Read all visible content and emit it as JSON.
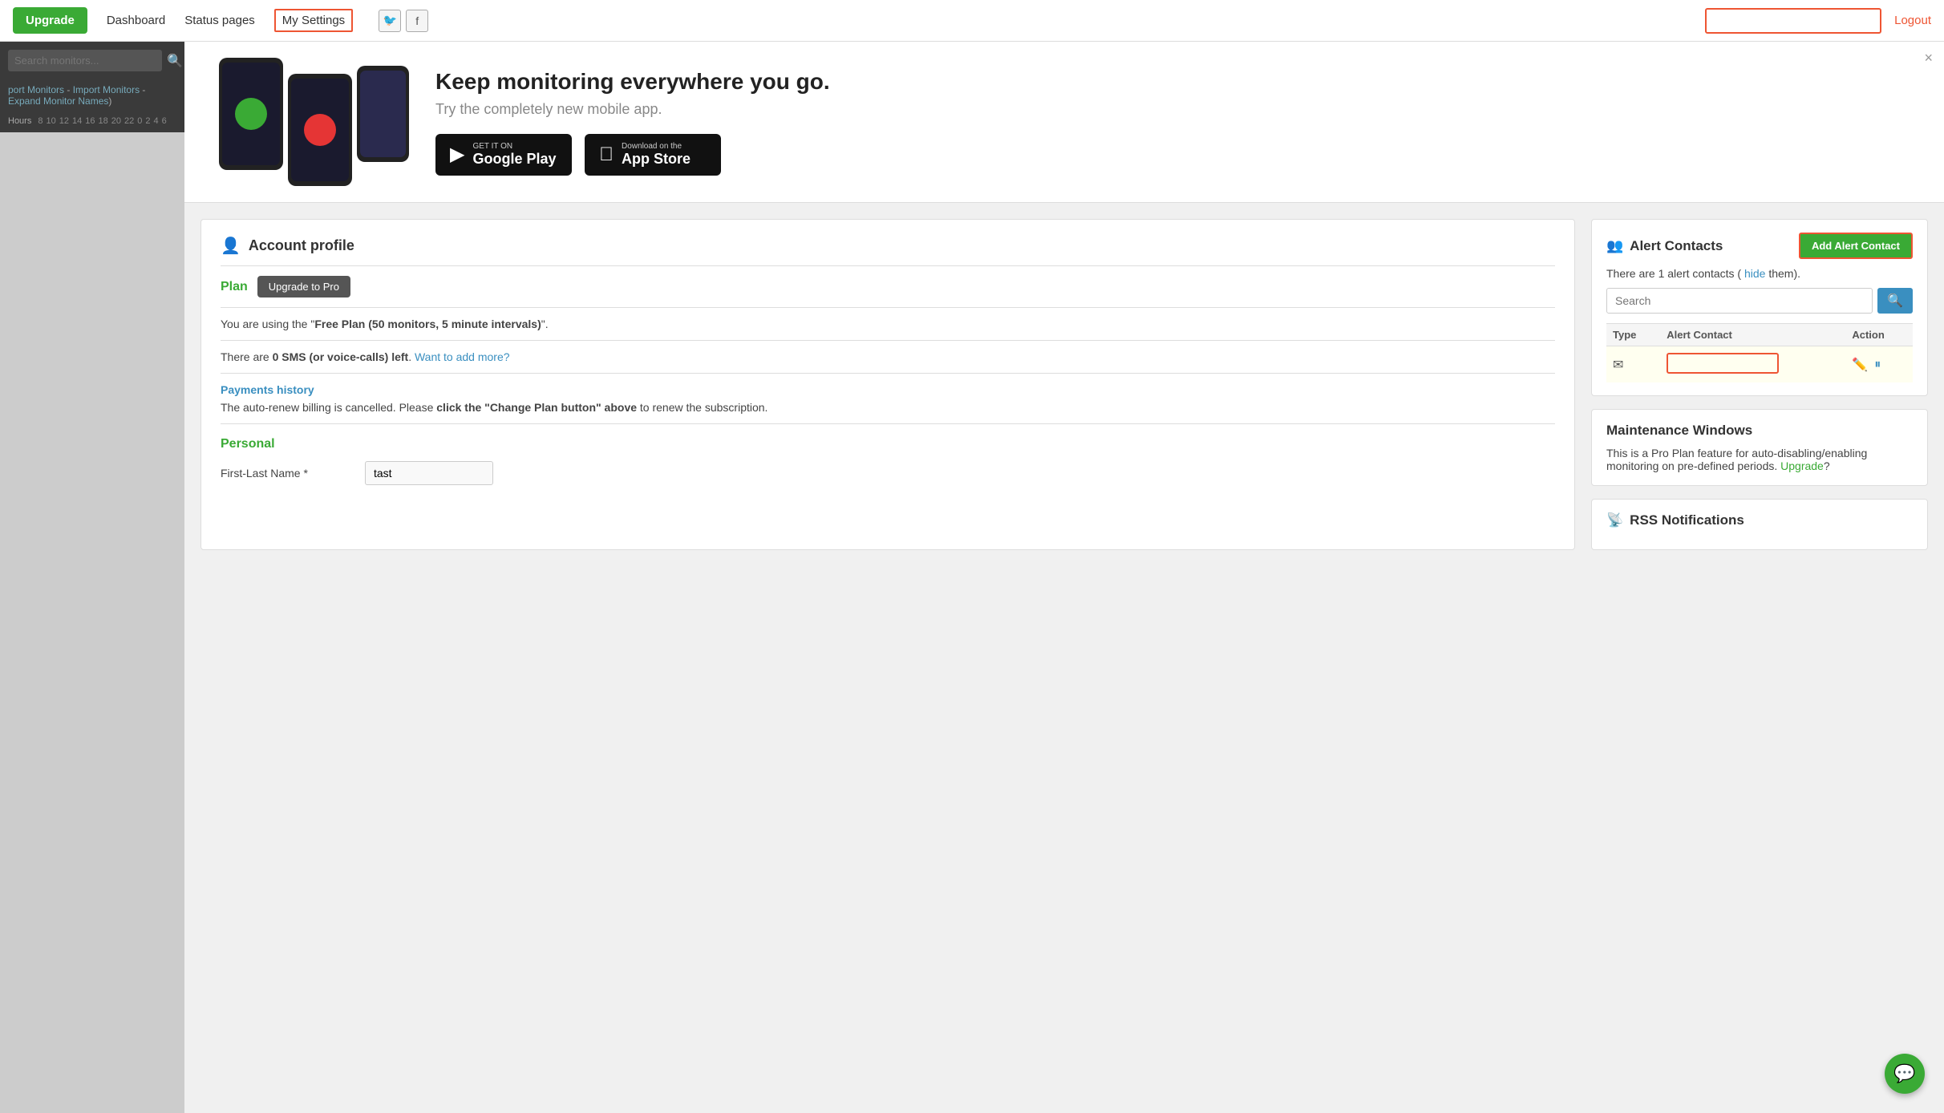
{
  "nav": {
    "upgrade_label": "Upgrade",
    "dashboard_label": "Dashboard",
    "status_pages_label": "Status pages",
    "my_settings_label": "My Settings",
    "logout_label": "Logout",
    "search_placeholder": ""
  },
  "sidebar": {
    "search_placeholder": "Search monitors...",
    "links": {
      "export": "port Monitors",
      "import": "Import Monitors",
      "expand": "Expand Monitor Names"
    },
    "hours_label": "Hours",
    "hours": [
      "8",
      "10",
      "12",
      "14",
      "16",
      "18",
      "20",
      "22",
      "0",
      "2",
      "4",
      "6"
    ]
  },
  "banner": {
    "headline": "Keep monitoring everywhere you go.",
    "subtext": "Try the completely new mobile app.",
    "close": "×",
    "google_play_top": "GET IT ON",
    "google_play_main": "Google Play",
    "app_store_top": "Download on the",
    "app_store_main": "App Store"
  },
  "account_profile": {
    "section_title": "Account profile",
    "plan_label": "Plan",
    "upgrade_pro_label": "Upgrade to Pro",
    "plan_desc_prefix": "You are using the \"",
    "plan_name": "Free Plan (50 monitors, 5 minute intervals)",
    "plan_desc_suffix": "\".",
    "sms_text_prefix": "There are ",
    "sms_bold": "0 SMS (or voice-calls) left",
    "sms_text_suffix": ". ",
    "sms_link": "Want to add more?",
    "payments_link": "Payments history",
    "payments_desc_prefix": "The auto-renew billing is cancelled. Please ",
    "payments_desc_bold": "click the \"Change Plan button\" above",
    "payments_desc_suffix": " to renew the subscription.",
    "personal_label": "Personal",
    "first_last_label": "First-Last Name *",
    "first_last_value": "tast"
  },
  "alert_contacts": {
    "section_title": "Alert Contacts",
    "add_btn_label": "Add Alert Contact",
    "info_text_prefix": "There are 1 alert contacts ( ",
    "hide_link": "hide",
    "info_text_suffix": "them).",
    "search_placeholder": "Search",
    "table": {
      "col_type": "Type",
      "col_contact": "Alert Contact",
      "col_action": "Action"
    },
    "row": {
      "type_icon": "✉",
      "contact_value": ""
    }
  },
  "maintenance_windows": {
    "section_title": "Maintenance Windows",
    "desc_prefix": "This is a Pro Plan feature for auto-disabling/enabling monitoring on pre-defined periods. ",
    "upgrade_link": "Upgrade",
    "desc_suffix": "?"
  },
  "rss_notifications": {
    "section_title": "RSS Notifications"
  },
  "chat": {
    "icon": "💬"
  },
  "social": {
    "twitter": "🐦",
    "facebook": "f"
  }
}
